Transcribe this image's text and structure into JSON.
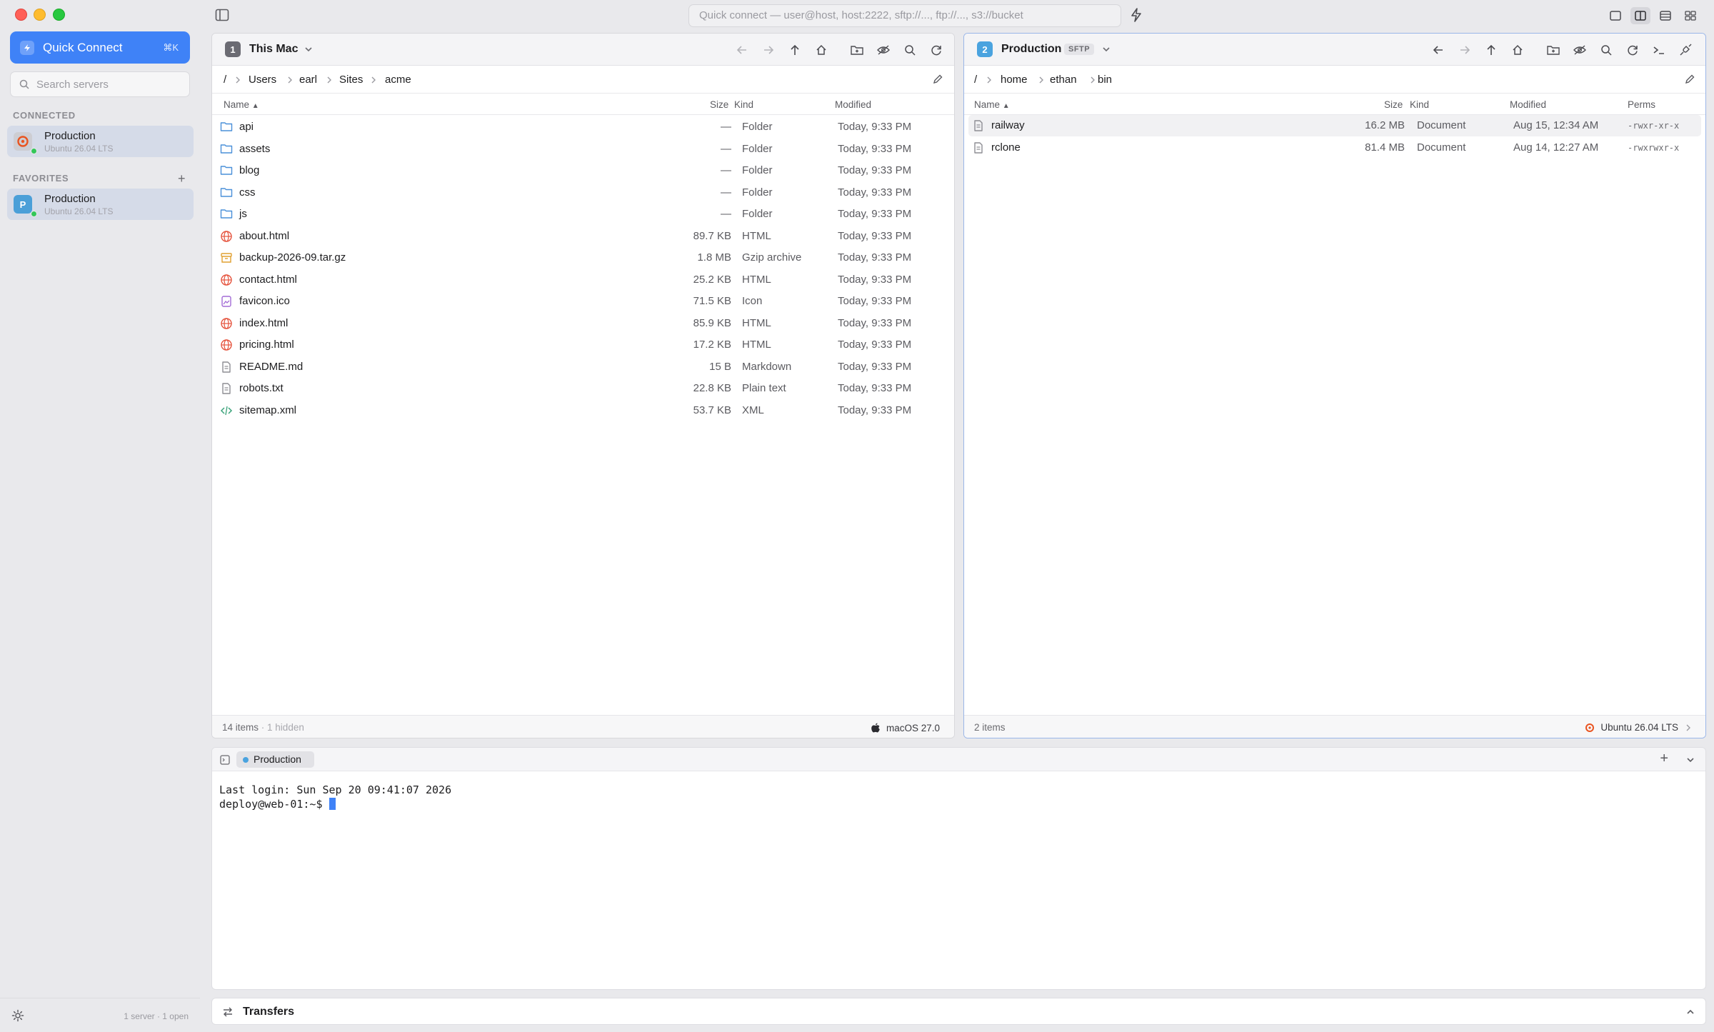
{
  "titlebar": {
    "quick_connect_placeholder": "Quick connect — user@host, host:2222, sftp://..., ftp://..., s3://bucket"
  },
  "sidebar": {
    "quick_connect_label": "Quick Connect",
    "quick_connect_shortcut": "⌘K",
    "search_placeholder": "Search servers",
    "connected_label": "CONNECTED",
    "favorites_label": "FAVORITES",
    "connected_items": [
      {
        "name": "Production",
        "subtitle": "Ubuntu 26.04 LTS"
      }
    ],
    "favorite_items": [
      {
        "name": "Production",
        "subtitle": "Ubuntu 26.04 LTS",
        "initial": "P"
      }
    ],
    "footer_status": "1 server · 1 open"
  },
  "left_pane": {
    "number": "1",
    "title": "This Mac",
    "path": [
      "/",
      "Users",
      "earl",
      "Sites",
      "acme"
    ],
    "columns": {
      "name": "Name",
      "size": "Size",
      "kind": "Kind",
      "modified": "Modified"
    },
    "rows": [
      {
        "name": "api",
        "size": "—",
        "kind": "Folder",
        "modified": "Today, 9:33 PM",
        "icon": "folder-icon"
      },
      {
        "name": "assets",
        "size": "—",
        "kind": "Folder",
        "modified": "Today, 9:33 PM",
        "icon": "folder-icon"
      },
      {
        "name": "blog",
        "size": "—",
        "kind": "Folder",
        "modified": "Today, 9:33 PM",
        "icon": "folder-icon"
      },
      {
        "name": "css",
        "size": "—",
        "kind": "Folder",
        "modified": "Today, 9:33 PM",
        "icon": "folder-icon"
      },
      {
        "name": "js",
        "size": "—",
        "kind": "Folder",
        "modified": "Today, 9:33 PM",
        "icon": "folder-icon"
      },
      {
        "name": "about.html",
        "size": "89.7 KB",
        "kind": "HTML",
        "modified": "Today, 9:33 PM",
        "icon": "globe-icon"
      },
      {
        "name": "backup-2026-09.tar.gz",
        "size": "1.8 MB",
        "kind": "Gzip archive",
        "modified": "Today, 9:33 PM",
        "icon": "archive-icon"
      },
      {
        "name": "contact.html",
        "size": "25.2 KB",
        "kind": "HTML",
        "modified": "Today, 9:33 PM",
        "icon": "globe-icon"
      },
      {
        "name": "favicon.ico",
        "size": "71.5 KB",
        "kind": "Icon",
        "modified": "Today, 9:33 PM",
        "icon": "image-icon"
      },
      {
        "name": "index.html",
        "size": "85.9 KB",
        "kind": "HTML",
        "modified": "Today, 9:33 PM",
        "icon": "globe-icon"
      },
      {
        "name": "pricing.html",
        "size": "17.2 KB",
        "kind": "HTML",
        "modified": "Today, 9:33 PM",
        "icon": "globe-icon"
      },
      {
        "name": "README.md",
        "size": "15 B",
        "kind": "Markdown",
        "modified": "Today, 9:33 PM",
        "icon": "text-file-icon"
      },
      {
        "name": "robots.txt",
        "size": "22.8 KB",
        "kind": "Plain text",
        "modified": "Today, 9:33 PM",
        "icon": "text-file-icon"
      },
      {
        "name": "sitemap.xml",
        "size": "53.7 KB",
        "kind": "XML",
        "modified": "Today, 9:33 PM",
        "icon": "code-icon"
      }
    ],
    "footer_count": "14 items",
    "footer_hidden": "· 1 hidden",
    "footer_os": "macOS 27.0"
  },
  "right_pane": {
    "number": "2",
    "title": "Production",
    "protocol": "SFTP",
    "path": [
      "/",
      "home",
      "ethan",
      "bin"
    ],
    "columns": {
      "name": "Name",
      "size": "Size",
      "kind": "Kind",
      "modified": "Modified",
      "perms": "Perms"
    },
    "rows": [
      {
        "name": "railway",
        "size": "16.2 MB",
        "kind": "Document",
        "modified": "Aug 15, 12:34 AM",
        "perms": "-rwxr-xr-x",
        "selected": true
      },
      {
        "name": "rclone",
        "size": "81.4 MB",
        "kind": "Document",
        "modified": "Aug 14, 12:27 AM",
        "perms": "-rwxrwxr-x",
        "selected": false
      }
    ],
    "footer_count": "2 items",
    "footer_os": "Ubuntu 26.04 LTS"
  },
  "terminal": {
    "tab_label": "Production",
    "line1": "Last login: Sun Sep 20 09:41:07 2026",
    "prompt": "deploy@web-01:~$ "
  },
  "transfers": {
    "label": "Transfers"
  },
  "colors": {
    "accent": "#3f82f7",
    "connected_green": "#34c759",
    "ubuntu_orange": "#e95420"
  }
}
